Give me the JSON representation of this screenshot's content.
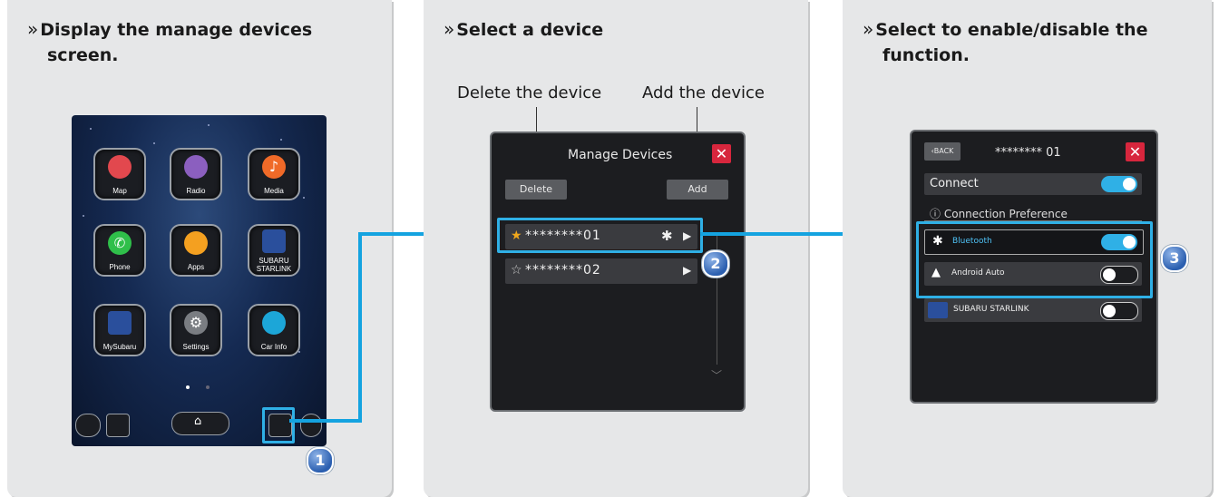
{
  "panels": [
    {
      "heading_line1": "Display the manage devices",
      "heading_line2": "screen."
    },
    {
      "heading_line1": "Select a device"
    },
    {
      "heading_line1": "Select to enable/disable the",
      "heading_line2": "function."
    }
  ],
  "home_apps": [
    {
      "label": "Map",
      "icon": "map-icon",
      "color": "#e2484e"
    },
    {
      "label": "Radio",
      "icon": "radio-icon",
      "color": "#8b5fbf"
    },
    {
      "label": "Media",
      "icon": "music-note-icon",
      "color": "#f06a28"
    },
    {
      "label": "Phone",
      "icon": "phone-icon",
      "color": "#2fbf4a"
    },
    {
      "label": "Apps",
      "icon": "apps-grid-icon",
      "color": "#f4a020"
    },
    {
      "label": "SUBARU\nSTARLINK",
      "icon": "starlink-icon",
      "color": "#2a4f9c"
    },
    {
      "label": "MySubaru",
      "icon": "mysubaru-icon",
      "color": "#2a4f9c"
    },
    {
      "label": "Settings",
      "icon": "settings-gear-icon",
      "color": "#7a7d82"
    },
    {
      "label": "Car Info",
      "icon": "car-info-icon",
      "color": "#1ca6d8"
    }
  ],
  "callouts": {
    "delete": "Delete the device",
    "add": "Add the device"
  },
  "manage": {
    "title": "Manage Devices",
    "close": "✕",
    "delete_btn": "Delete",
    "add_btn": "Add",
    "devices": [
      {
        "star": "★",
        "name": "********01"
      },
      {
        "star": "☆",
        "name": "********02"
      }
    ]
  },
  "device_detail": {
    "back": "BACK",
    "title": "******** 01",
    "close": "✕",
    "connect": "Connect",
    "pref_header": "Connection Preference",
    "options": [
      {
        "label": "Bluetooth",
        "on": true
      },
      {
        "label": "Android Auto",
        "on": false
      },
      {
        "label": "SUBARU STARLINK",
        "on": false
      }
    ]
  },
  "steps": [
    "1",
    "2",
    "3"
  ],
  "colors": {
    "accent": "#14a3e0",
    "toggle_on": "#2fb0e6",
    "close_red": "#d7263d"
  }
}
